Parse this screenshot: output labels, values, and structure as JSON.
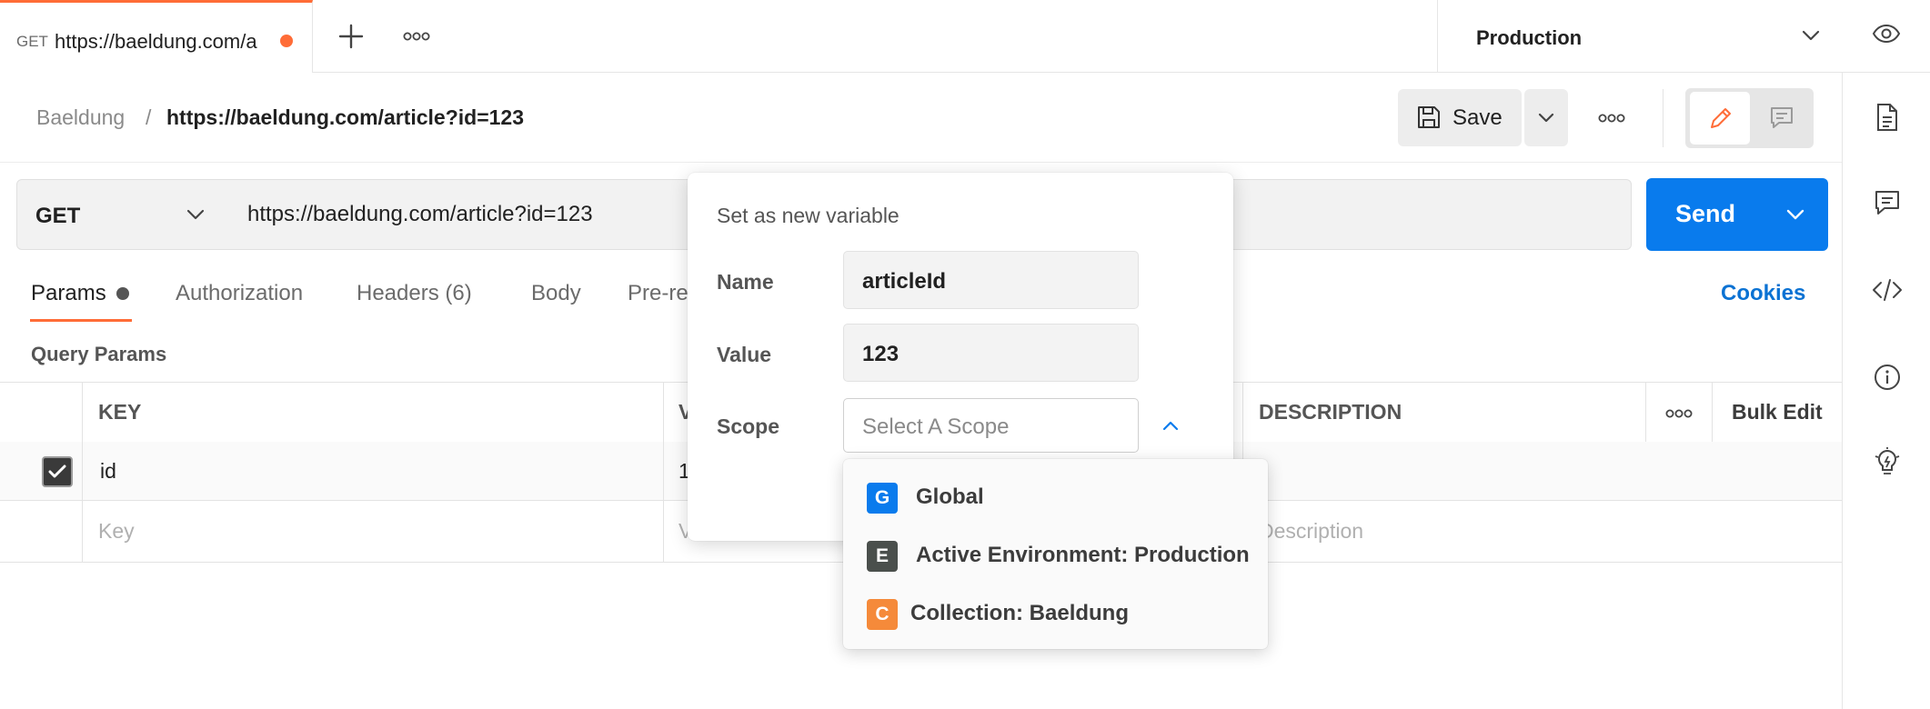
{
  "tab": {
    "method": "GET",
    "url": "https://baeldung.com/a",
    "unsaved": true
  },
  "environment": {
    "selected": "Production"
  },
  "breadcrumb": {
    "parent": "Baeldung",
    "separator": "/",
    "current": "https://baeldung.com/article?id=123"
  },
  "toolbar": {
    "save_label": "Save"
  },
  "request": {
    "method": "GET",
    "url": "https://baeldung.com/article?id=123",
    "send_label": "Send"
  },
  "subtabs": {
    "params": "Params",
    "authorization": "Authorization",
    "headers": "Headers (6)",
    "body": "Body",
    "prerequest": "Pre-re",
    "cookies": "Cookies"
  },
  "query_params": {
    "title": "Query Params",
    "headers": {
      "key": "KEY",
      "value": "V",
      "description": "DESCRIPTION",
      "bulk_edit": "Bulk Edit"
    },
    "rows": [
      {
        "checked": true,
        "key": "id",
        "value": "1"
      }
    ],
    "placeholder": {
      "key": "Key",
      "value": "V",
      "description": "Description"
    }
  },
  "popover": {
    "title": "Set as new variable",
    "name_label": "Name",
    "name_value": "articleId",
    "value_label": "Value",
    "value_value": "123",
    "scope_label": "Scope",
    "scope_placeholder": "Select A Scope"
  },
  "scope_menu": [
    {
      "badge": "G",
      "label": "Global",
      "color": "#097bed"
    },
    {
      "badge": "E",
      "label": "Active Environment: Production",
      "color": "#4a4f4c"
    },
    {
      "badge": "C",
      "label": "Collection: Baeldung",
      "color": "#f58a3a"
    }
  ],
  "colors": {
    "accent": "#ff6c37",
    "primary": "#097bed",
    "link": "#0b72d3"
  },
  "icons": [
    "plus-icon",
    "more-icon",
    "chevron-down-icon",
    "eye-icon",
    "save-icon",
    "pencil-icon",
    "comment-icon",
    "document-icon",
    "code-icon",
    "info-icon",
    "lightbulb-icon",
    "chevron-up-icon",
    "checkmark-icon"
  ]
}
